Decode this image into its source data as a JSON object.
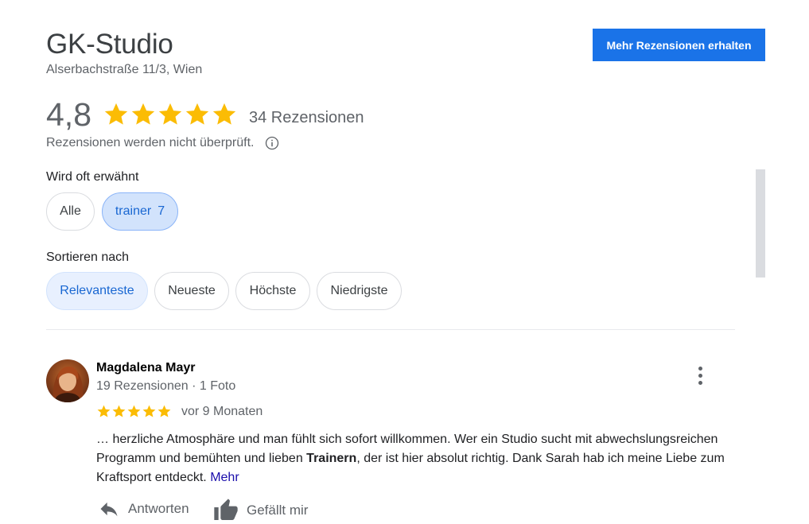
{
  "business": {
    "name": "GK-Studio",
    "address": "Alserbachstraße 11/3, Wien"
  },
  "cta_label": "Mehr Rezensionen erhalten",
  "rating": {
    "value": "4,8",
    "stars": 5,
    "review_count_label": "34 Rezensionen",
    "note": "Rezensionen werden nicht überprüft.",
    "star_color": "#fbbc04"
  },
  "mentions": {
    "label": "Wird oft erwähnt",
    "chips": [
      {
        "label": "Alle"
      },
      {
        "label": "trainer",
        "count": "7"
      }
    ]
  },
  "sort": {
    "label": "Sortieren nach",
    "options": [
      "Relevanteste",
      "Neueste",
      "Höchste",
      "Niedrigste"
    ],
    "selected": "Relevanteste"
  },
  "review": {
    "author": "Magdalena Mayr",
    "meta": "19 Rezensionen · 1 Foto",
    "stars": 5,
    "time": "vor 9 Monaten",
    "text_before": "… herzliche Atmosphäre und man fühlt sich sofort willkommen. Wer ein Studio sucht mit abwechslungsreichen Programm und bemühten und lieben ",
    "text_bold": "Trainern",
    "text_after": ", der ist hier absolut richtig. Dank Sarah hab ich meine Liebe zum Kraftsport entdeckt. ",
    "more_label": "Mehr",
    "actions": {
      "reply": "Antworten",
      "like": "Gefällt mir"
    }
  },
  "colors": {
    "accent": "#1a73e8",
    "chip_selected_bg": "#d2e3fc",
    "link": "#1a0dab"
  }
}
